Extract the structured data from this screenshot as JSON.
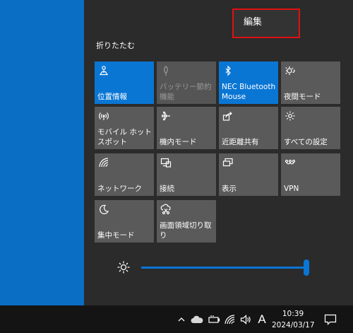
{
  "edit_button": {
    "label": "編集"
  },
  "collapse_label": "折りたたむ",
  "tiles": [
    {
      "label": "位置情報",
      "icon": "location-icon",
      "state": "active"
    },
    {
      "label": "バッテリー節約機能",
      "icon": "battery-saver-icon",
      "state": "disabled"
    },
    {
      "label": "NEC Bluetooth Mouse",
      "icon": "bluetooth-icon",
      "state": "active"
    },
    {
      "label": "夜間モード",
      "icon": "night-light-icon",
      "state": "off"
    },
    {
      "label": "モバイル ホットスポット",
      "icon": "mobile-hotspot-icon",
      "state": "off"
    },
    {
      "label": "機内モード",
      "icon": "airplane-icon",
      "state": "off"
    },
    {
      "label": "近距離共有",
      "icon": "nearby-share-icon",
      "state": "off"
    },
    {
      "label": "すべての設定",
      "icon": "gear-icon",
      "state": "off"
    },
    {
      "label": "ネットワーク",
      "icon": "network-icon",
      "state": "off"
    },
    {
      "label": "接続",
      "icon": "connect-icon",
      "state": "off"
    },
    {
      "label": "表示",
      "icon": "project-icon",
      "state": "off"
    },
    {
      "label": "VPN",
      "icon": "vpn-icon",
      "state": "off"
    },
    {
      "label": "集中モード",
      "icon": "moon-icon",
      "state": "off"
    },
    {
      "label": "画面領域切り取り",
      "icon": "screen-snip-icon",
      "state": "off"
    }
  ],
  "brightness": {
    "icon": "brightness-icon",
    "level": 1.0
  },
  "taskbar": {
    "input_indicator": "A",
    "time": "10:39",
    "date": "2024/03/17",
    "icons": [
      "chevron-up-icon",
      "cloud-icon",
      "battery-icon",
      "wifi-icon",
      "volume-icon",
      "notification-icon"
    ]
  },
  "colors": {
    "accent": "#0a76d4",
    "tile": "#5a5a5a",
    "panel": "#2b2b2b",
    "desktop": "#0a6ec4",
    "highlight": "#e01010"
  }
}
